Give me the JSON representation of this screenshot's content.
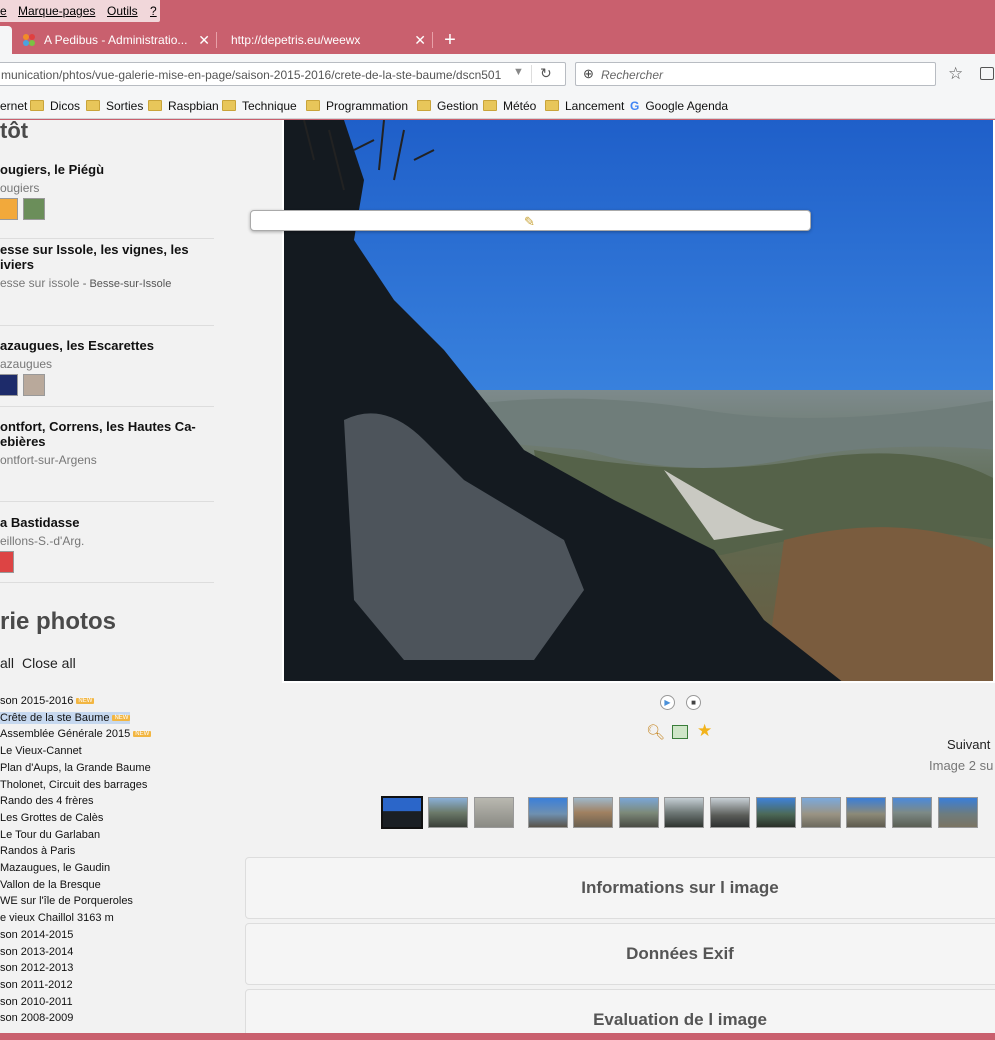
{
  "menu": {
    "items": [
      "e",
      "Marque-pages",
      "Outils",
      "?"
    ]
  },
  "tabs": [
    {
      "label": "A Pedibus - Administratio...",
      "active": true
    },
    {
      "label": "http://depetris.eu/weewx",
      "active": false
    }
  ],
  "navbar": {
    "url": "munication/phtos/vue-galerie-mise-en-page/saison-2015-2016/crete-de-la-ste-baume/dscn501",
    "search_placeholder": "Rechercher"
  },
  "bookmarks": [
    {
      "label": "ernet",
      "folder": false
    },
    {
      "label": "Dicos",
      "folder": true
    },
    {
      "label": "Sorties",
      "folder": true
    },
    {
      "label": "Raspbian",
      "folder": true
    },
    {
      "label": "Technique",
      "folder": true
    },
    {
      "label": "Programmation",
      "folder": true
    },
    {
      "label": "Gestion",
      "folder": true
    },
    {
      "label": "Météo",
      "folder": true
    },
    {
      "label": "Lancement",
      "folder": true
    },
    {
      "label": "Google Agenda",
      "folder": false
    }
  ],
  "sidebar": {
    "section_title": "tôt",
    "events": [
      {
        "title": "ougiers, le Piégù",
        "place": "ougiers"
      },
      {
        "title": "esse sur Issole, les vignes, les\niviers",
        "place": "esse sur issole",
        "place2": "- Besse-sur-Issole"
      },
      {
        "title": "azaugues, les Escarettes",
        "place": "azaugues"
      },
      {
        "title": "ontfort, Correns, les Hautes Ca-\nebières",
        "place": "ontfort-sur-Argens"
      },
      {
        "title": "a Bastidasse",
        "place": "eillons-S.-d'Arg."
      }
    ],
    "gallery_title": "rie photos",
    "open_all": "all",
    "close_all": "Close all",
    "tree": [
      {
        "label": "son 2015-2016",
        "new": true
      },
      {
        "label": "Crête de la ste Baume",
        "new": true,
        "selected": true
      },
      {
        "label": "Assemblée Générale 2015",
        "new": true
      },
      {
        "label": "Le Vieux-Cannet"
      },
      {
        "label": "Plan d'Aups, la Grande Baume"
      },
      {
        "label": "Tholonet, Circuit des barrages"
      },
      {
        "label": "Rando des 4 frères"
      },
      {
        "label": "Les Grottes de Calès"
      },
      {
        "label": "Le Tour du Garlaban"
      },
      {
        "label": "Randos à Paris"
      },
      {
        "label": "Mazaugues, le Gaudin"
      },
      {
        "label": "Vallon de la Bresque"
      },
      {
        "label": "WE sur l'île de Porqueroles"
      },
      {
        "label": "e vieux Chaillol 3163 m"
      },
      {
        "label": "son 2014-2015"
      },
      {
        "label": "son 2013-2014"
      },
      {
        "label": "son 2012-2013"
      },
      {
        "label": "son 2011-2012"
      },
      {
        "label": "son 2010-2011"
      },
      {
        "label": "son 2008-2009"
      }
    ],
    "new_badge": "NEW"
  },
  "viewer": {
    "next_label": "Suivant",
    "image_counter": "Image 2 su"
  },
  "panels": [
    "Informations sur l image",
    "Données Exif",
    "Evaluation de l image"
  ]
}
